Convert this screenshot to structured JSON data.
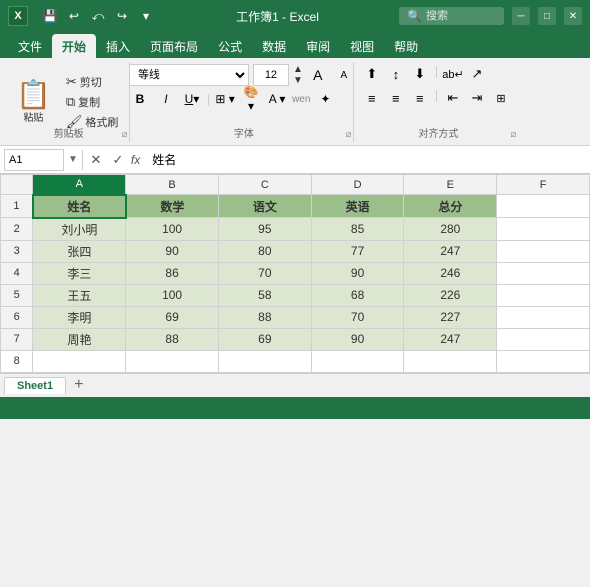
{
  "titlebar": {
    "title": "工作簿1 - Excel",
    "search_placeholder": "搜索"
  },
  "ribbon": {
    "tabs": [
      "文件",
      "开始",
      "插入",
      "页面布局",
      "公式",
      "数据",
      "审阅",
      "视图",
      "帮助"
    ],
    "active_tab": "开始",
    "groups": {
      "clipboard": {
        "label": "剪贴板",
        "paste": "粘贴",
        "cut": "剪切",
        "copy": "复制",
        "format_painter": "格式刷"
      },
      "font": {
        "label": "字体",
        "name": "等线",
        "size": "12",
        "bold": "B",
        "italic": "I",
        "underline": "U"
      },
      "alignment": {
        "label": "对齐方式"
      }
    }
  },
  "formula_bar": {
    "cell_ref": "A1",
    "formula": "姓名"
  },
  "spreadsheet": {
    "col_headers": [
      "",
      "A",
      "B",
      "C",
      "D",
      "E",
      "F"
    ],
    "rows": [
      {
        "row_num": "1",
        "cells": [
          "姓名",
          "数学",
          "语文",
          "英语",
          "总分",
          ""
        ],
        "is_header": true
      },
      {
        "row_num": "2",
        "cells": [
          "刘小明",
          "100",
          "95",
          "85",
          "280",
          ""
        ],
        "is_header": false
      },
      {
        "row_num": "3",
        "cells": [
          "张四",
          "90",
          "80",
          "77",
          "247",
          ""
        ],
        "is_header": false
      },
      {
        "row_num": "4",
        "cells": [
          "李三",
          "86",
          "70",
          "90",
          "246",
          ""
        ],
        "is_header": false
      },
      {
        "row_num": "5",
        "cells": [
          "王五",
          "100",
          "58",
          "68",
          "226",
          ""
        ],
        "is_header": false
      },
      {
        "row_num": "6",
        "cells": [
          "李明",
          "69",
          "88",
          "70",
          "227",
          ""
        ],
        "is_header": false
      },
      {
        "row_num": "7",
        "cells": [
          "周艳",
          "88",
          "69",
          "90",
          "247",
          ""
        ],
        "is_header": false
      },
      {
        "row_num": "8",
        "cells": [
          "",
          "",
          "",
          "",
          "",
          ""
        ],
        "is_header": false,
        "empty": true
      }
    ]
  },
  "sheet_tabs": {
    "sheets": [
      "Sheet1"
    ]
  },
  "status_bar": {
    "text": ""
  }
}
